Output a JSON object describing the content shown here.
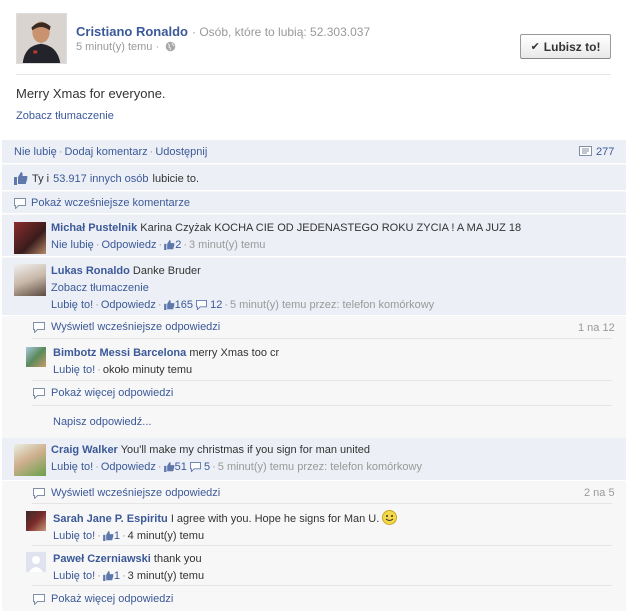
{
  "post": {
    "author": "Cristiano Ronaldo",
    "likes_text": "· Osób, które to lubią: 52.303.037",
    "time": "5 minut(y) temu ·",
    "like_button": "Lubisz to!",
    "text": "Merry Xmas for everyone.",
    "see_translation": "Zobacz tłumaczenie"
  },
  "actions": {
    "unlike": "Nie lubię",
    "comment": "Dodaj komentarz",
    "share": "Udostępnij",
    "comments_count": "277"
  },
  "likes_line": {
    "you": "Ty i",
    "others": "53.917 innych osób",
    "suffix": "lubicie to."
  },
  "show_previous_comments": "Pokaż wcześniejsze komentarze",
  "comments": [
    {
      "author": "Michał Pustelnik",
      "text": "Karina Czyżak KOCHA CIE OD JEDENASTEGO ROKU ZYCIA ! A MA JUZ 18",
      "like": "Nie lubię",
      "reply": "Odpowiedz",
      "likes": "2",
      "time": "3 minut(y) temu"
    },
    {
      "author": "Lukas Ronaldo",
      "text": "Danke Bruder",
      "see_translation": "Zobacz tłumaczenie",
      "like": "Lubię to!",
      "reply": "Odpowiedz",
      "likes": "165",
      "replies": "12",
      "time": "5 minut(y) temu przez: telefon komórkowy",
      "show_previous_replies": "Wyświetl wcześniejsze odpowiedzi",
      "reply_range": "1 na 12",
      "sub_replies": [
        {
          "author": "Bimbotz Messi Barcelona",
          "text": "merry Xmas too cr",
          "like": "Lubię to!",
          "time": "około minuty temu"
        }
      ],
      "show_more_replies": "Pokaż więcej odpowiedzi",
      "write_reply": "Napisz odpowiedź..."
    },
    {
      "author": "Craig Walker",
      "text": "You'll make my christmas if you sign for man united",
      "like": "Lubię to!",
      "reply": "Odpowiedz",
      "likes": "51",
      "replies": "5",
      "time": "5 minut(y) temu przez: telefon komórkowy",
      "show_previous_replies": "Wyświetl wcześniejsze odpowiedzi",
      "reply_range": "2 na 5",
      "sub_replies": [
        {
          "author": "Sarah Jane P. Espiritu",
          "text": "I agree with you. Hope he signs for Man U.",
          "like": "Lubię to!",
          "likes": "1",
          "time": "4 minut(y) temu"
        },
        {
          "author": "Paweł Czerniawski",
          "text": "thank you",
          "like": "Lubię to!",
          "likes": "1",
          "time": "3 minut(y) temu"
        }
      ],
      "show_more_replies": "Pokaż więcej odpowiedzi"
    }
  ],
  "colors": {
    "link": "#3b5998",
    "muted": "#999999",
    "comment_bg": "#eceff5",
    "reply_bg": "#f7f7f7"
  }
}
